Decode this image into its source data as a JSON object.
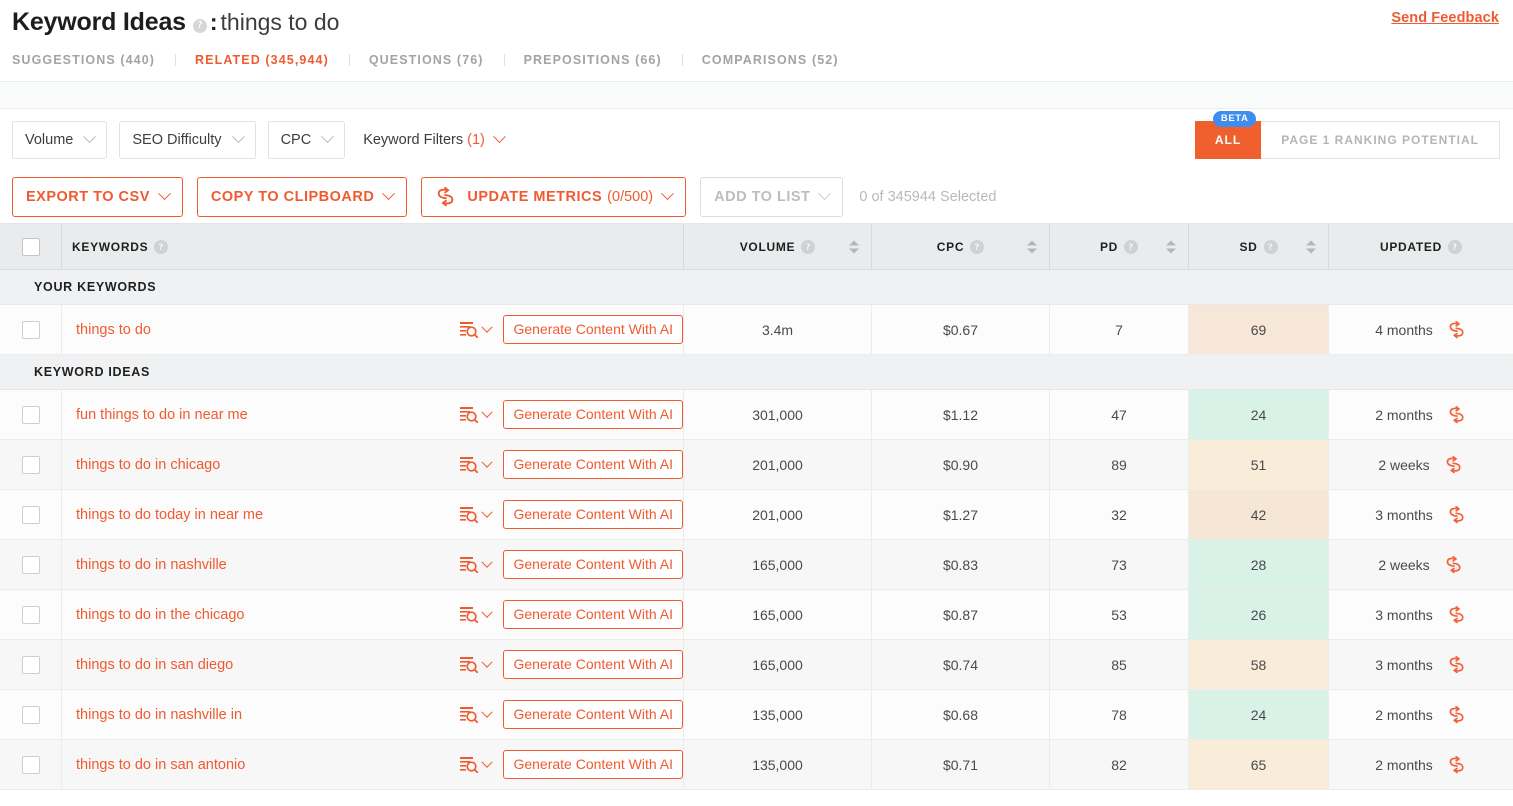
{
  "header": {
    "title": "Keyword Ideas",
    "help_icon": "?",
    "separator": ":",
    "query": "things to do",
    "send_feedback": "Send Feedback"
  },
  "tabs": [
    {
      "label": "SUGGESTIONS (440)",
      "active": false
    },
    {
      "label": "RELATED (345,944)",
      "active": true
    },
    {
      "label": "QUESTIONS (76)",
      "active": false
    },
    {
      "label": "PREPOSITIONS (66)",
      "active": false
    },
    {
      "label": "COMPARISONS (52)",
      "active": false
    }
  ],
  "filters": {
    "volume": "Volume",
    "seo_difficulty": "SEO Difficulty",
    "cpc": "CPC",
    "keyword_filters": "Keyword Filters",
    "keyword_filters_count": "(1)",
    "beta_badge": "BETA",
    "toggle_all": "ALL",
    "toggle_page1": "PAGE 1 RANKING POTENTIAL"
  },
  "actions": {
    "export_csv": "EXPORT TO CSV",
    "copy_clipboard": "COPY TO CLIPBOARD",
    "update_metrics": "UPDATE METRICS",
    "update_metrics_count": "(0/500)",
    "add_to_list": "ADD TO LIST",
    "selected_text": "0 of 345944 Selected"
  },
  "table": {
    "columns": [
      {
        "label": "KEYWORDS",
        "help": "?",
        "sortable": false
      },
      {
        "label": "VOLUME",
        "help": "?",
        "sortable": true
      },
      {
        "label": "CPC",
        "help": "?",
        "sortable": true
      },
      {
        "label": "PD",
        "help": "?",
        "sortable": true
      },
      {
        "label": "SD",
        "help": "?",
        "sortable": true
      },
      {
        "label": "UPDATED",
        "help": "?",
        "sortable": false
      }
    ],
    "section_your_keywords": "YOUR KEYWORDS",
    "section_keyword_ideas": "KEYWORD IDEAS",
    "generate_label": "Generate Content With AI",
    "your_keywords": [
      {
        "keyword": "things to do",
        "volume": "3.4m",
        "cpc": "$0.67",
        "pd": "7",
        "sd": "69",
        "sd_color": "#f6e7d8",
        "updated": "4 months"
      }
    ],
    "keyword_ideas": [
      {
        "keyword": "fun things to do in near me",
        "volume": "301,000",
        "cpc": "$1.12",
        "pd": "47",
        "sd": "24",
        "sd_color": "#d9f2e8",
        "updated": "2 months"
      },
      {
        "keyword": "things to do in chicago",
        "volume": "201,000",
        "cpc": "$0.90",
        "pd": "89",
        "sd": "51",
        "sd_color": "#f9ecd9",
        "updated": "2 weeks"
      },
      {
        "keyword": "things to do today in near me",
        "volume": "201,000",
        "cpc": "$1.27",
        "pd": "32",
        "sd": "42",
        "sd_color": "#f6e6d6",
        "updated": "3 months"
      },
      {
        "keyword": "things to do in nashville",
        "volume": "165,000",
        "cpc": "$0.83",
        "pd": "73",
        "sd": "28",
        "sd_color": "#d9f2e8",
        "updated": "2 weeks"
      },
      {
        "keyword": "things to do in the chicago",
        "volume": "165,000",
        "cpc": "$0.87",
        "pd": "53",
        "sd": "26",
        "sd_color": "#d9f2e8",
        "updated": "3 months"
      },
      {
        "keyword": "things to do in san diego",
        "volume": "165,000",
        "cpc": "$0.74",
        "pd": "85",
        "sd": "58",
        "sd_color": "#f9ecd9",
        "updated": "3 months"
      },
      {
        "keyword": "things to do in nashville in",
        "volume": "135,000",
        "cpc": "$0.68",
        "pd": "78",
        "sd": "24",
        "sd_color": "#d9f2e8",
        "updated": "2 months"
      },
      {
        "keyword": "things to do in san antonio",
        "volume": "135,000",
        "cpc": "$0.71",
        "pd": "82",
        "sd": "65",
        "sd_color": "#f9ecd9",
        "updated": "2 months"
      }
    ]
  },
  "colors": {
    "accent": "#ef5b31",
    "accent_solid": "#f0602f",
    "beta_blue": "#3e8ef0",
    "muted": "#a3a3a3",
    "header_bg": "#e9ebec",
    "section_bg": "#f0f1f3"
  }
}
